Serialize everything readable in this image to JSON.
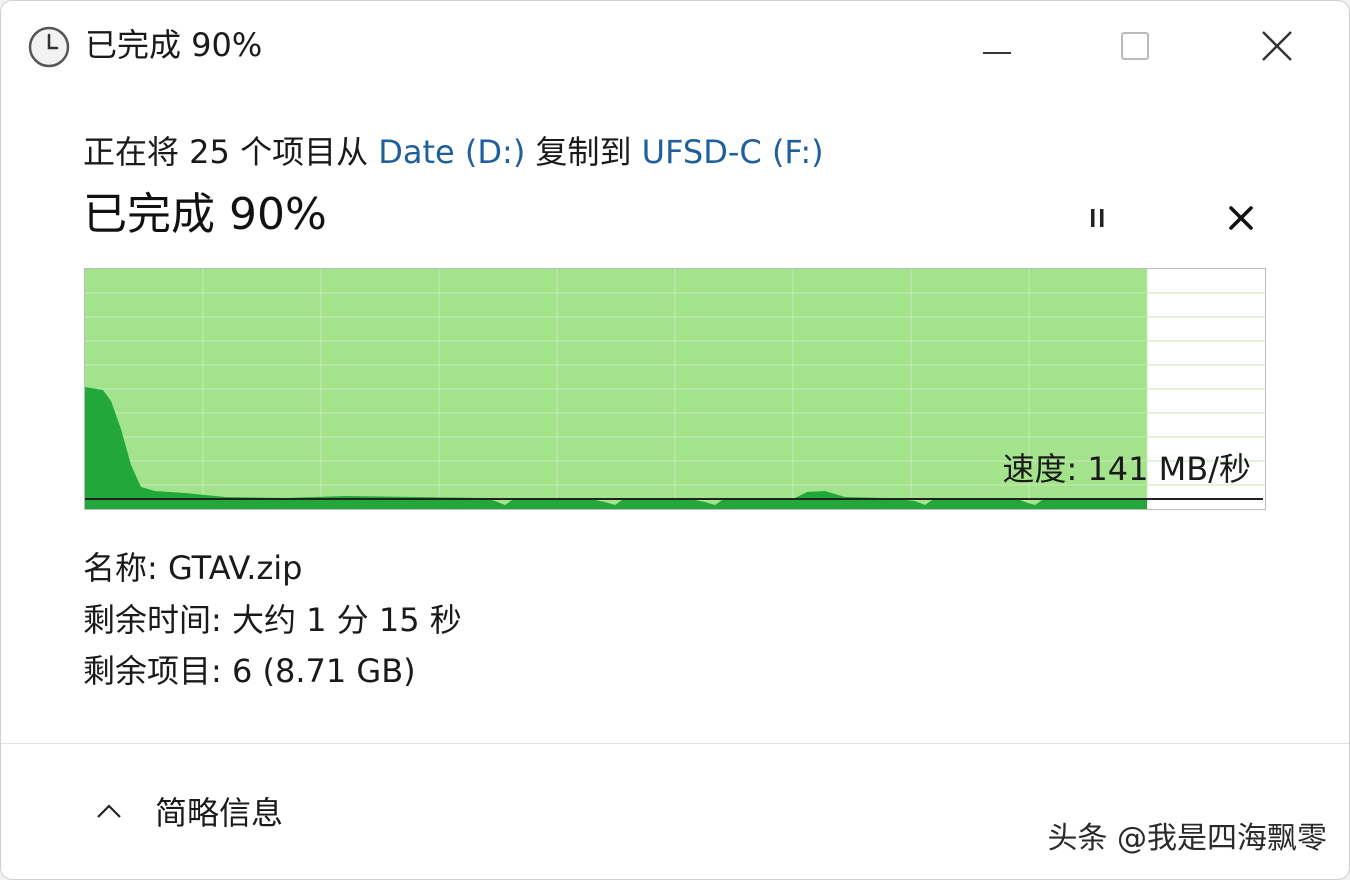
{
  "window": {
    "title": "已完成 90%",
    "icon": "clock-icon"
  },
  "copy": {
    "prefix": "正在将 25 个项目从 ",
    "source": "Date (D:)",
    "middle": " 复制到 ",
    "destination": "UFSD-C (F:)"
  },
  "progress": {
    "title": "已完成 90%",
    "percent": 90
  },
  "graph": {
    "speed_label": "速度: 141 MB/秒",
    "colors": {
      "progress_fill": "#a3e38c",
      "speed_area": "#22a83a",
      "grid": "#c7e8b8",
      "speed_line": "#222222"
    }
  },
  "info": {
    "name_label": "名称: ",
    "name_value": "GTAV.zip",
    "time_label": "剩余时间: ",
    "time_value": "大约 1 分 15 秒",
    "items_label": "剩余项目: ",
    "items_value": "6 (8.71 GB)"
  },
  "footer": {
    "details_label": "简略信息",
    "details_icon": "chevron-up-icon"
  },
  "watermark": "头条 @我是四海飘零"
}
